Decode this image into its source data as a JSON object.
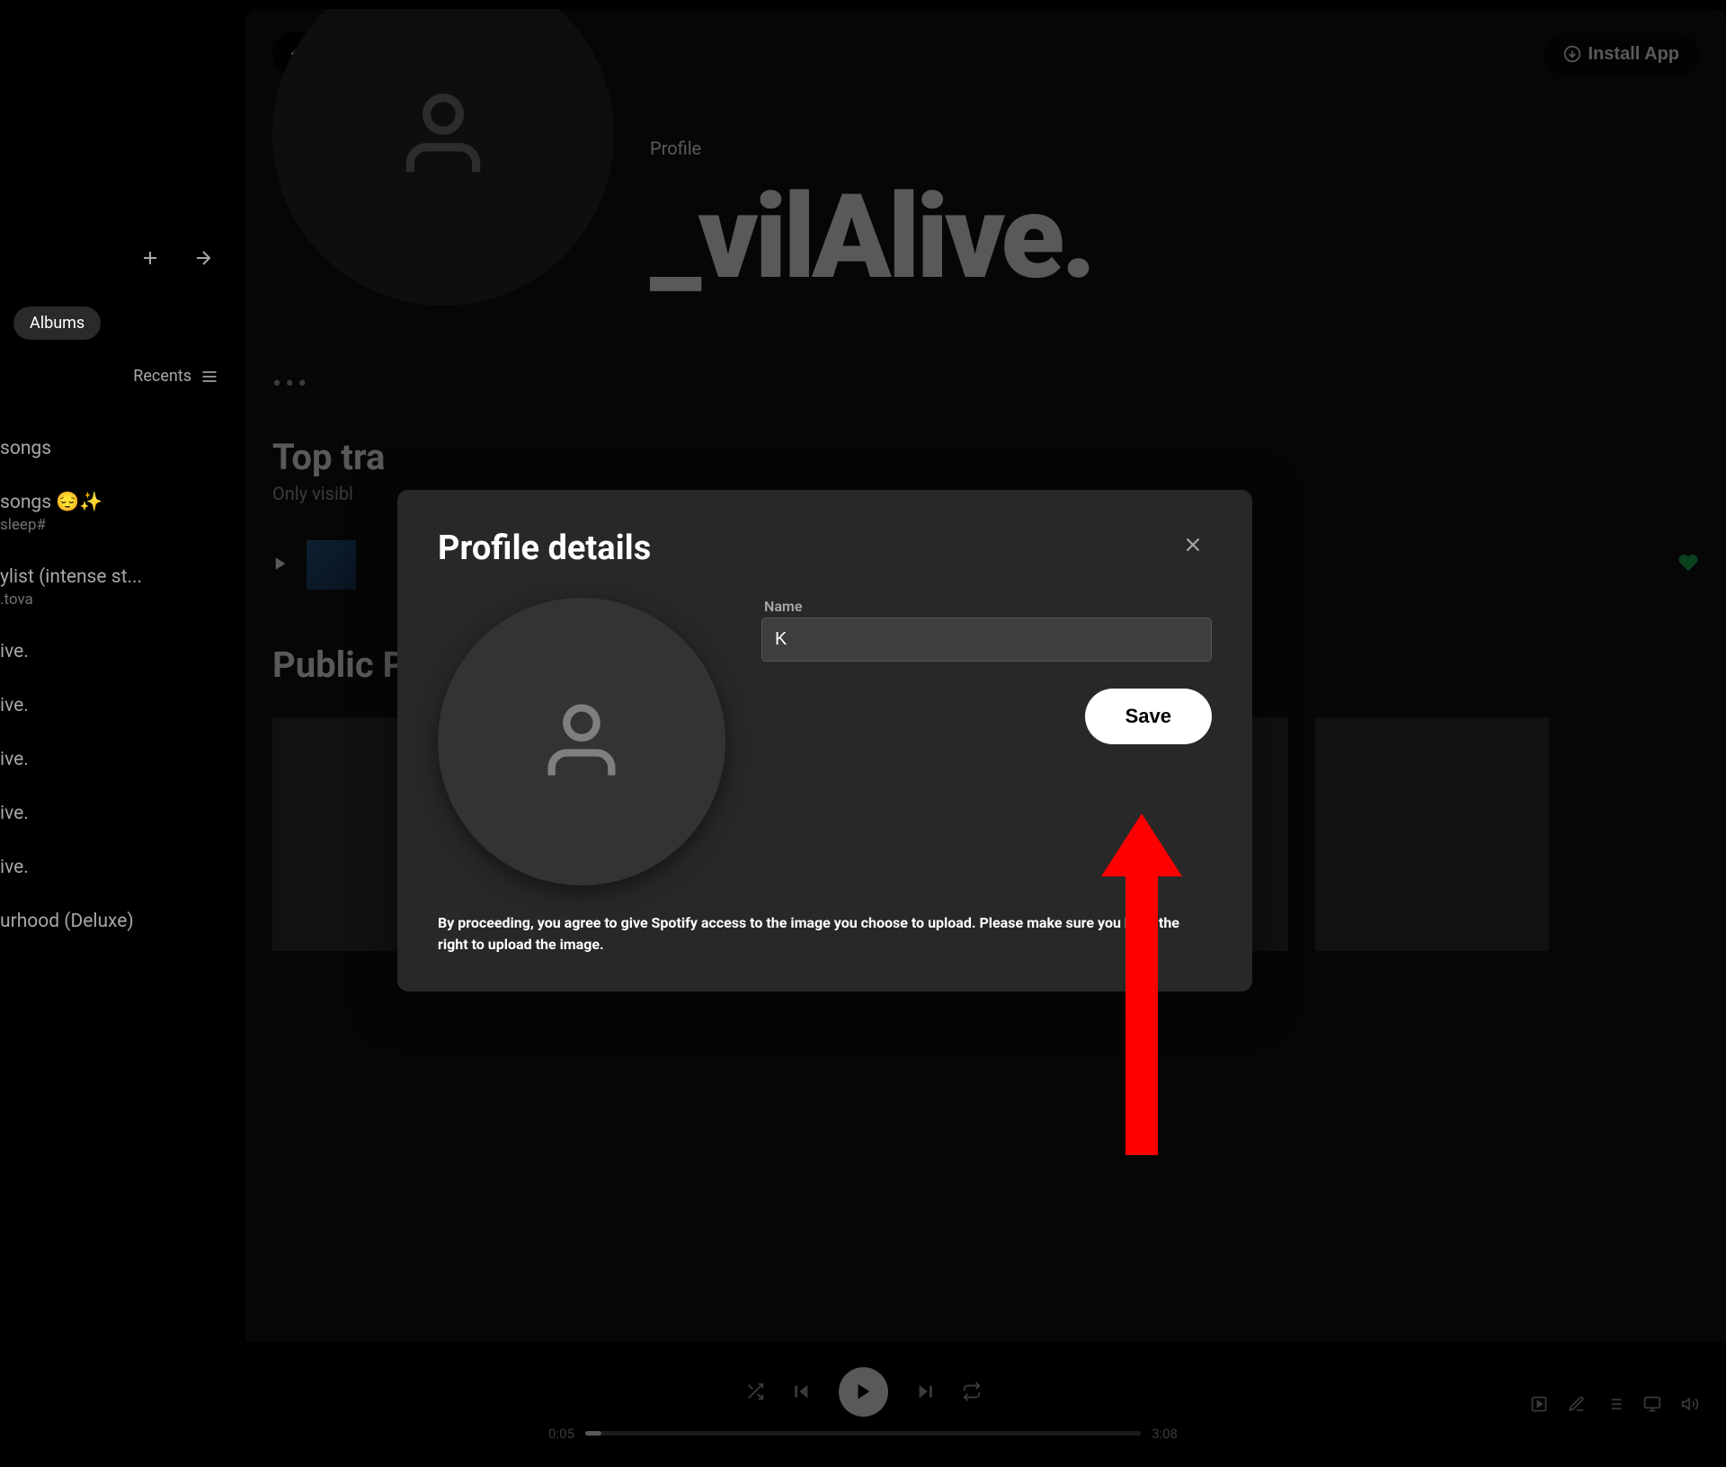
{
  "sidebar": {
    "albums_pill": "Albums",
    "recents_label": "Recents",
    "items": [
      {
        "label": " songs",
        "sub": ""
      },
      {
        "label": "songs 😔✨",
        "sub": " sleep#"
      },
      {
        "label": "ylist (intense st...",
        "sub": ".tova"
      },
      {
        "label": "ive.",
        "sub": ""
      },
      {
        "label": "ive.",
        "sub": ""
      },
      {
        "label": "ive.",
        "sub": ""
      },
      {
        "label": "ive.",
        "sub": ""
      },
      {
        "label": "ive.",
        "sub": ""
      },
      {
        "label": "urhood (Deluxe)",
        "sub": ""
      }
    ]
  },
  "header": {
    "install_label": "Install App"
  },
  "profile": {
    "label": "Profile",
    "name": "_vilAlive."
  },
  "sections": {
    "top_tracks_title": "Top tra",
    "top_tracks_sub": "Only visibl",
    "playlists_title": "Public Playlists"
  },
  "modal": {
    "title": "Profile details",
    "name_label": "Name",
    "name_value": "K",
    "save_label": "Save",
    "disclaimer": "By proceeding, you agree to give Spotify access to the image you choose to upload. Please make sure you have the right to upload the image."
  },
  "player": {
    "current_time": "0:05",
    "total_time": "3:08"
  }
}
